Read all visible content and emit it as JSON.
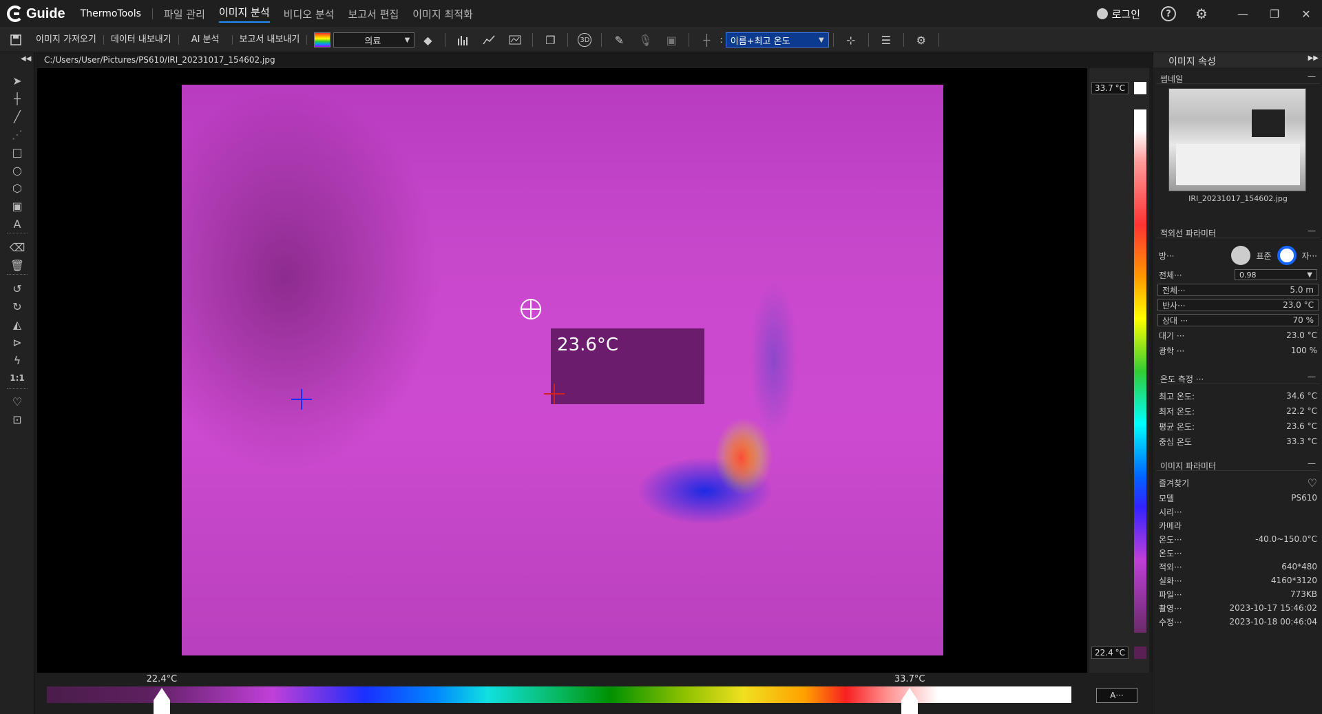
{
  "titlebar": {
    "logo_text": "Guide",
    "app_name": "ThermoTools",
    "menu": [
      "파일 관리",
      "이미지 분석",
      "비디오 분석",
      "보고서 편집",
      "이미지 최적화"
    ],
    "active_menu": "이미지 분석",
    "login_label": "로그인",
    "help_icon": "?",
    "settings_icon": "⚙",
    "minimize": "—",
    "restore": "❐",
    "close": "✕"
  },
  "toolbar": {
    "import_label": "이미지 가져오기",
    "export_data_label": "데이터 내보내기",
    "ai_label": "AI 분석",
    "export_report_label": "보고서 내보내기",
    "palette_value": "의료",
    "display_mode_value": "이름+최고 온도",
    "label_3d": "3D",
    "colon": ":"
  },
  "path": "C:/Users/User/Pictures/PS610/IRI_20231017_154602.jpg",
  "canvas": {
    "temp_label": "23.6°C"
  },
  "scale": {
    "max": "33.7",
    "min": "22.4",
    "unit": "°C"
  },
  "bottom_bar": {
    "low_label": "22.4°C",
    "high_label": "33.7°C",
    "auto_button": "A···",
    "low_fraction": 0.112,
    "high_fraction": 0.842
  },
  "right_panel": {
    "title": "이미지 속성",
    "thumbnail": {
      "section": "썸네일",
      "filename": "IRI_20231017_154602.jpg"
    },
    "ir_params": {
      "section": "적외선 파라미터",
      "mode_label": "방···",
      "standard_label": "표준",
      "self_label": "자···",
      "emissivity_label": "전체···",
      "emissivity_value": "0.98",
      "rows": [
        {
          "label": "전체···",
          "value": "5.0 m"
        },
        {
          "label": "반사···",
          "value": "23.0 °C"
        },
        {
          "label": "상대 ···",
          "value": "70 %"
        },
        {
          "label": "대기 ···",
          "value": "23.0 °C"
        },
        {
          "label": "광학 ···",
          "value": "100 %"
        }
      ]
    },
    "temp_measure": {
      "section": "온도 측정 ···",
      "rows": [
        {
          "label": "최고 온도:",
          "value": "34.6 °C"
        },
        {
          "label": "최저 온도:",
          "value": "22.2 °C"
        },
        {
          "label": "평균 온도:",
          "value": "23.6 °C"
        },
        {
          "label": "중심 온도",
          "value": "33.3 °C"
        }
      ]
    },
    "image_params": {
      "section": "이미지 파라미터",
      "favorites": "즐겨찾기",
      "rows": [
        {
          "label": "모델",
          "value": "PS610"
        },
        {
          "label": "시리···",
          "value": ""
        },
        {
          "label": "카메라",
          "value": ""
        },
        {
          "label": "온도···",
          "value": "-40.0~150.0°C"
        },
        {
          "label": "온도···",
          "value": ""
        },
        {
          "label": "적외···",
          "value": "640*480"
        },
        {
          "label": "실화···",
          "value": "4160*3120"
        },
        {
          "label": "파일···",
          "value": "773KB"
        },
        {
          "label": "촬영···",
          "value": "2023-10-17 15:46:02"
        },
        {
          "label": "수정···",
          "value": "2023-10-18 00:46:04"
        }
      ]
    }
  }
}
